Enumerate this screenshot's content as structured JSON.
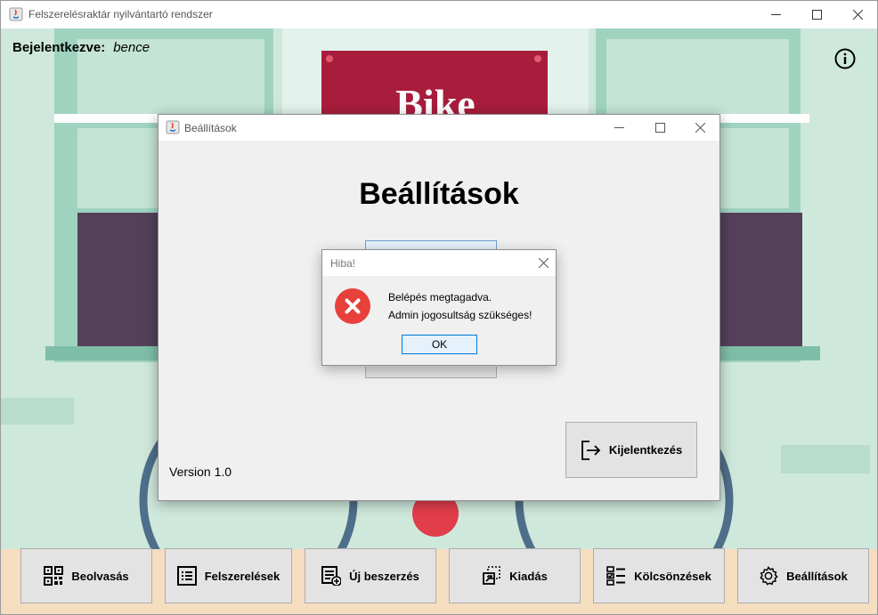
{
  "main_window": {
    "title": "Felszerelésraktár nyilvántartó rendszer",
    "user_label": "Bejelentkezve:",
    "user_value": "bence"
  },
  "background": {
    "sign_text": "Bike"
  },
  "toolbar": {
    "buttons": [
      {
        "label": "Beolvasás",
        "icon": "qr-code-icon"
      },
      {
        "label": "Felszerelések",
        "icon": "list-icon"
      },
      {
        "label": "Új beszerzés",
        "icon": "add-list-icon"
      },
      {
        "label": "Kiadás",
        "icon": "handout-icon"
      },
      {
        "label": "Kölcsönzések",
        "icon": "checklist-icon"
      },
      {
        "label": "Beállítások",
        "icon": "gear-icon"
      }
    ]
  },
  "settings_dialog": {
    "title": "Beállítások",
    "heading": "Beállítások",
    "version": "Version 1.0",
    "logout_label": "Kijelentkezés"
  },
  "error_dialog": {
    "title": "Hiba!",
    "line1": "Belépés megtagadva.",
    "line2": "Admin jogosultság szükséges!",
    "ok_label": "OK"
  },
  "colors": {
    "background_mint": "#cfe8dc",
    "sign_red": "#a81d3c",
    "purple_panel": "#54405b",
    "error_red": "#e8403a",
    "ok_border": "#0078d7"
  }
}
